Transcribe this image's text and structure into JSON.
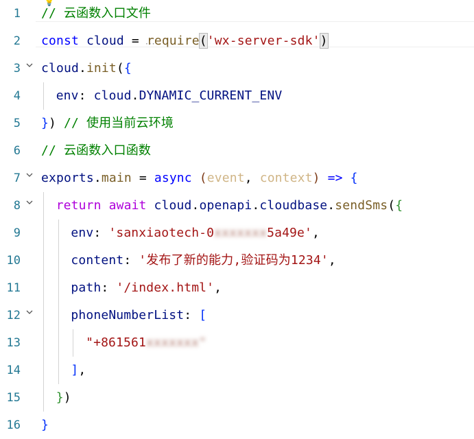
{
  "editor": {
    "lines": [
      {
        "num": "1",
        "parts": [
          [
            "c-comment",
            "// 云函数入口文件"
          ]
        ],
        "indent": 0
      },
      {
        "num": "2",
        "parts": [
          [
            "c-kw",
            "const"
          ],
          [
            "c-plain",
            " "
          ],
          [
            "c-var",
            "cloud"
          ],
          [
            "c-plain",
            " = "
          ],
          [
            "c-fn",
            "require"
          ],
          [
            "c-plain",
            "("
          ],
          [
            "c-str",
            "'wx-server-sdk'"
          ],
          [
            "c-plain",
            ")"
          ]
        ],
        "indent": 0
      },
      {
        "num": "3",
        "parts": [
          [
            "c-var",
            "cloud"
          ],
          [
            "c-plain",
            "."
          ],
          [
            "c-fn",
            "init"
          ],
          [
            "c-plain",
            "("
          ],
          [
            "c-bracket1",
            "{"
          ]
        ],
        "indent": 0,
        "fold": true
      },
      {
        "num": "4",
        "parts": [
          [
            "c-attr-key",
            "env"
          ],
          [
            "c-plain",
            ": "
          ],
          [
            "c-var",
            "cloud"
          ],
          [
            "c-plain",
            "."
          ],
          [
            "c-var",
            "DYNAMIC_CURRENT_ENV"
          ]
        ],
        "indent": 1
      },
      {
        "num": "5",
        "parts": [
          [
            "c-bracket1",
            "}"
          ],
          [
            "c-plain",
            ") "
          ],
          [
            "c-comment",
            "// 使用当前云环境"
          ]
        ],
        "indent": 0
      },
      {
        "num": "6",
        "parts": [
          [
            "c-comment",
            "// 云函数入口函数"
          ]
        ],
        "indent": 0
      },
      {
        "num": "7",
        "parts": [
          [
            "c-var",
            "exports"
          ],
          [
            "c-plain",
            "."
          ],
          [
            "c-fn",
            "main"
          ],
          [
            "c-plain",
            " = "
          ],
          [
            "c-kw",
            "async"
          ],
          [
            "c-plain",
            " "
          ],
          [
            "c-brace2",
            "("
          ],
          [
            "c-param",
            "event"
          ],
          [
            "c-plain",
            ", "
          ],
          [
            "c-param",
            "context"
          ],
          [
            "c-brace2",
            ")"
          ],
          [
            "c-plain",
            " "
          ],
          [
            "c-kw",
            "=>"
          ],
          [
            "c-plain",
            " "
          ],
          [
            "c-bracket1",
            "{"
          ]
        ],
        "indent": 0,
        "fold": true
      },
      {
        "num": "8",
        "parts": [
          [
            "c-ctrl",
            "return"
          ],
          [
            "c-plain",
            " "
          ],
          [
            "c-ctrl",
            "await"
          ],
          [
            "c-plain",
            " "
          ],
          [
            "c-var",
            "cloud"
          ],
          [
            "c-plain",
            "."
          ],
          [
            "c-var",
            "openapi"
          ],
          [
            "c-plain",
            "."
          ],
          [
            "c-var",
            "cloudbase"
          ],
          [
            "c-plain",
            "."
          ],
          [
            "c-fn",
            "sendSms"
          ],
          [
            "c-plain",
            "("
          ],
          [
            "c-brace",
            "{"
          ]
        ],
        "indent": 1,
        "fold": true
      },
      {
        "num": "9",
        "parts": [
          [
            "c-attr-key",
            "env"
          ],
          [
            "c-plain",
            ": "
          ],
          [
            "c-str",
            "'sanxiaotech-0"
          ],
          [
            "blur",
            "xxxxxxx"
          ],
          [
            "c-str",
            "5a49e'"
          ],
          [
            "c-plain",
            ","
          ]
        ],
        "indent": 2
      },
      {
        "num": "10",
        "parts": [
          [
            "c-attr-key",
            "content"
          ],
          [
            "c-plain",
            ": "
          ],
          [
            "c-str",
            "'发布了新的能力,验证码为1234'"
          ],
          [
            "c-plain",
            ","
          ]
        ],
        "indent": 2
      },
      {
        "num": "11",
        "parts": [
          [
            "c-attr-key",
            "path"
          ],
          [
            "c-plain",
            ": "
          ],
          [
            "c-str",
            "'/index.html'"
          ],
          [
            "c-plain",
            ","
          ]
        ],
        "indent": 2
      },
      {
        "num": "12",
        "parts": [
          [
            "c-attr-key",
            "phoneNumberList"
          ],
          [
            "c-plain",
            ": "
          ],
          [
            "c-bracket1",
            "["
          ]
        ],
        "indent": 2,
        "fold": true
      },
      {
        "num": "13",
        "parts": [
          [
            "c-str",
            "\"+861561"
          ],
          [
            "blur",
            "xxxxxxx\""
          ]
        ],
        "indent": 3
      },
      {
        "num": "14",
        "parts": [
          [
            "c-bracket1",
            "]"
          ],
          [
            "c-plain",
            ","
          ]
        ],
        "indent": 2
      },
      {
        "num": "15",
        "parts": [
          [
            "c-brace",
            "}"
          ],
          [
            "c-plain",
            ")"
          ]
        ],
        "indent": 1
      },
      {
        "num": "16",
        "parts": [
          [
            "c-bracket1",
            "}"
          ]
        ],
        "indent": 0
      }
    ],
    "icons": {
      "lightbulb": "lightbulb-icon",
      "fold": "chevron-down-icon"
    }
  }
}
